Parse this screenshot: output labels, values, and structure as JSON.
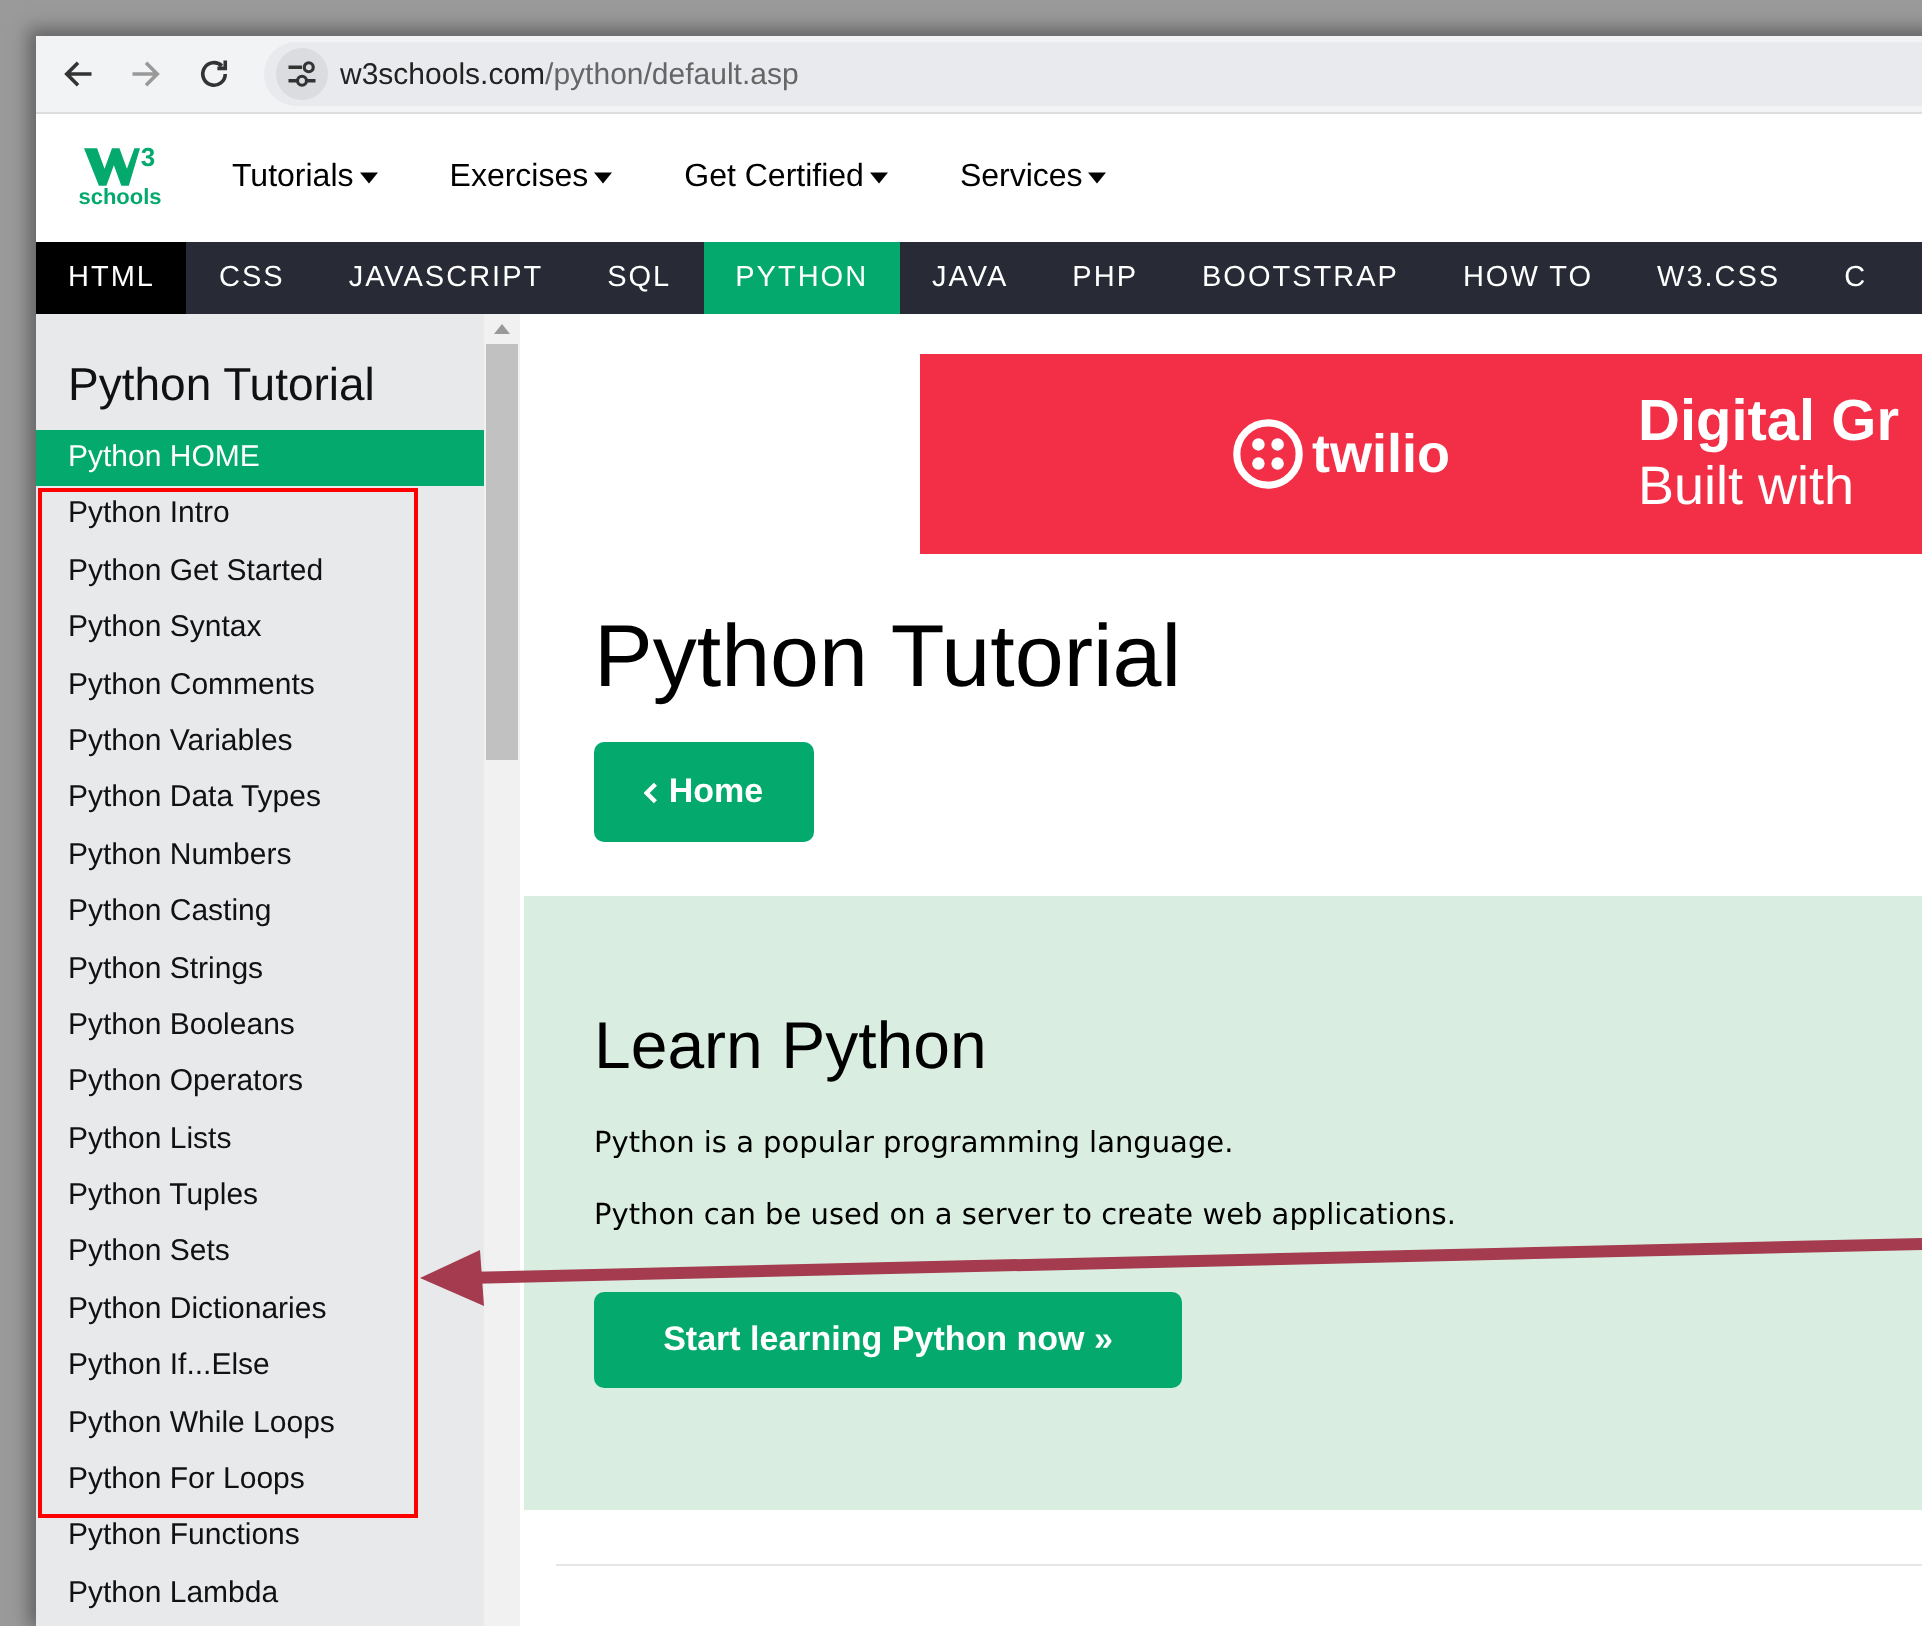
{
  "browser": {
    "url_host": "w3schools.com",
    "url_path": "/python/default.asp"
  },
  "logo": {
    "text": "schools",
    "sup": "3"
  },
  "nav_menu": [
    {
      "label": "Tutorials"
    },
    {
      "label": "Exercises"
    },
    {
      "label": "Get Certified"
    },
    {
      "label": "Services"
    }
  ],
  "topnav": [
    {
      "label": "HTML",
      "kind": "dark"
    },
    {
      "label": "CSS",
      "kind": "plain"
    },
    {
      "label": "JAVASCRIPT",
      "kind": "plain"
    },
    {
      "label": "SQL",
      "kind": "plain"
    },
    {
      "label": "PYTHON",
      "kind": "active"
    },
    {
      "label": "JAVA",
      "kind": "plain"
    },
    {
      "label": "PHP",
      "kind": "plain"
    },
    {
      "label": "BOOTSTRAP",
      "kind": "plain"
    },
    {
      "label": "HOW TO",
      "kind": "plain"
    },
    {
      "label": "W3.CSS",
      "kind": "plain"
    },
    {
      "label": "C",
      "kind": "plain"
    }
  ],
  "sidebar": {
    "title": "Python Tutorial",
    "items": [
      {
        "label": "Python HOME",
        "selected": true
      },
      {
        "label": "Python Intro",
        "selected": false
      },
      {
        "label": "Python Get Started",
        "selected": false
      },
      {
        "label": "Python Syntax",
        "selected": false
      },
      {
        "label": "Python Comments",
        "selected": false
      },
      {
        "label": "Python Variables",
        "selected": false
      },
      {
        "label": "Python Data Types",
        "selected": false
      },
      {
        "label": "Python Numbers",
        "selected": false
      },
      {
        "label": "Python Casting",
        "selected": false
      },
      {
        "label": "Python Strings",
        "selected": false
      },
      {
        "label": "Python Booleans",
        "selected": false
      },
      {
        "label": "Python Operators",
        "selected": false
      },
      {
        "label": "Python Lists",
        "selected": false
      },
      {
        "label": "Python Tuples",
        "selected": false
      },
      {
        "label": "Python Sets",
        "selected": false
      },
      {
        "label": "Python Dictionaries",
        "selected": false
      },
      {
        "label": "Python If...Else",
        "selected": false
      },
      {
        "label": "Python While Loops",
        "selected": false
      },
      {
        "label": "Python For Loops",
        "selected": false
      },
      {
        "label": "Python Functions",
        "selected": false
      },
      {
        "label": "Python Lambda",
        "selected": false
      }
    ]
  },
  "ad": {
    "brand": "twilio",
    "headline": "Digital Gr",
    "subline": "Built with"
  },
  "main": {
    "title": "Python Tutorial",
    "home_button": "Home",
    "learn": {
      "title": "Learn Python",
      "paragraphs": [
        "Python is a popular programming language.",
        "Python can be used on a server to create web applications."
      ],
      "button": "Start learning Python now »"
    }
  }
}
